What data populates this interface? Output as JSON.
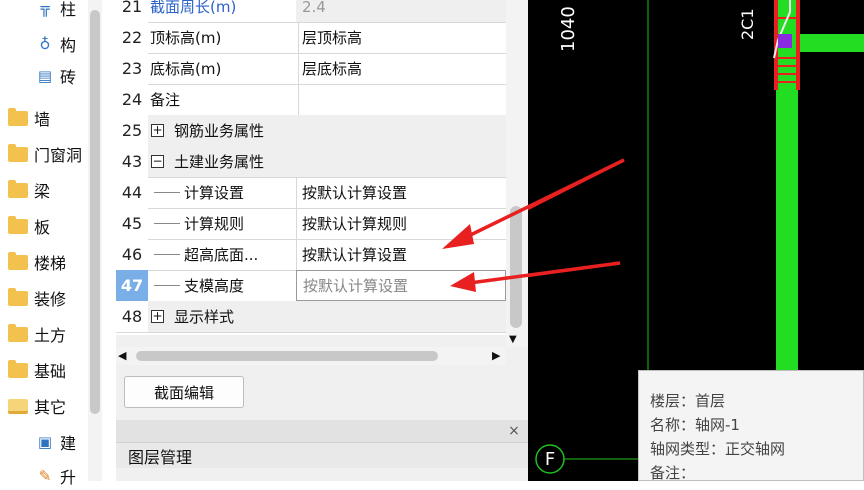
{
  "tree": {
    "items": [
      {
        "label": "柱",
        "icon": "column-icon",
        "sub": true
      },
      {
        "label": "构",
        "icon": "component-icon",
        "sub": true
      },
      {
        "label": "砖",
        "icon": "brick-icon",
        "sub": true
      },
      {
        "label": "墙",
        "icon": "folder-icon"
      },
      {
        "label": "门窗洞",
        "icon": "folder-icon"
      },
      {
        "label": "梁",
        "icon": "folder-icon"
      },
      {
        "label": "板",
        "icon": "folder-icon"
      },
      {
        "label": "楼梯",
        "icon": "folder-icon"
      },
      {
        "label": "装修",
        "icon": "folder-icon"
      },
      {
        "label": "土方",
        "icon": "folder-icon"
      },
      {
        "label": "基础",
        "icon": "folder-icon"
      },
      {
        "label": "其它",
        "icon": "folder-open-icon"
      },
      {
        "label": "建",
        "icon": "frame-icon",
        "sub": true
      },
      {
        "label": "升",
        "icon": "brush-icon",
        "sub": true
      }
    ]
  },
  "grid": {
    "rows": [
      {
        "num": "21",
        "name": "截面周长(m)",
        "value": "2.4"
      },
      {
        "num": "22",
        "name": "顶标高(m)",
        "value": "层顶标高"
      },
      {
        "num": "23",
        "name": "底标高(m)",
        "value": "层底标高"
      },
      {
        "num": "24",
        "name": "备注",
        "value": ""
      },
      {
        "num": "25",
        "name": "钢筋业务属性",
        "value": "",
        "expander": "+"
      },
      {
        "num": "43",
        "name": "土建业务属性",
        "value": "",
        "expander": "−"
      },
      {
        "num": "44",
        "name": "计算设置",
        "value": "按默认计算设置"
      },
      {
        "num": "45",
        "name": "计算规则",
        "value": "按默认计算规则"
      },
      {
        "num": "46",
        "name": "超高底面...",
        "value": "按默认计算设置"
      },
      {
        "num": "47",
        "name": "支模高度",
        "value": "按默认计算设置"
      },
      {
        "num": "48",
        "name": "显示样式",
        "value": "",
        "expander": "+"
      }
    ]
  },
  "buttons": {
    "section_edit": "截面编辑"
  },
  "layer_panel": {
    "title": "图层管理",
    "close": "×"
  },
  "cad": {
    "axis_label": "F",
    "dim_text": "1040",
    "component_text": "2C1",
    "tooltip": {
      "floor": "楼层：首层",
      "name": "名称：轴网-1",
      "type": "轴网类型：正交轴网",
      "note": "备注："
    }
  },
  "colors": {
    "wall_green": "#22dd22",
    "arrow_red": "#e82020",
    "selected_row": "#7aaee6",
    "cad_bg": "#000000"
  }
}
